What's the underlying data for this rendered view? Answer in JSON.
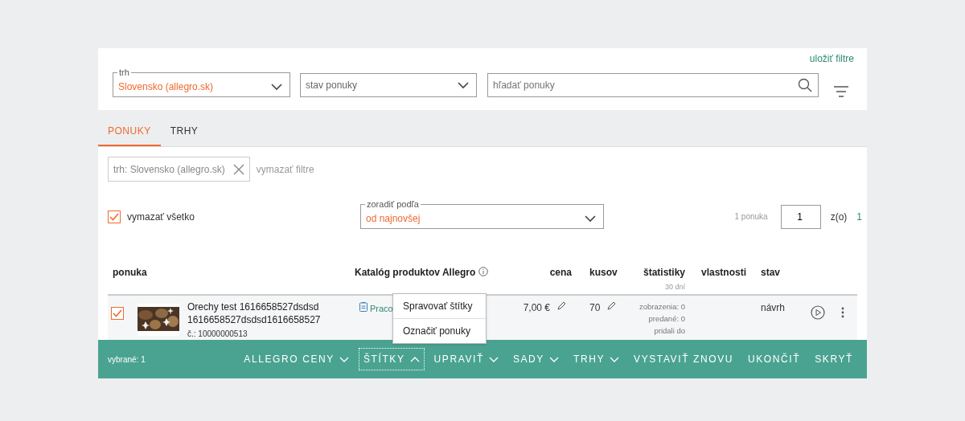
{
  "filters": {
    "save_link": "uložiť filtre",
    "market": {
      "label": "trh",
      "value": "Slovensko (allegro.sk)"
    },
    "status": {
      "placeholder": "stav ponuky"
    },
    "search": {
      "placeholder": "hľadať ponuky"
    }
  },
  "tabs": [
    {
      "label": "PONUKY",
      "selected": true
    },
    {
      "label": "TRHY",
      "selected": false
    }
  ],
  "active_filters": [
    {
      "text": "trh: Slovensko (allegro.sk)"
    }
  ],
  "clear_filters": "vymazať filtre",
  "select_all": {
    "label": "vymazať všetko",
    "checked": true
  },
  "sort": {
    "label": "zoradiť podľa",
    "value": "od najnovšej"
  },
  "pagination": {
    "count": "1 ponuka",
    "page": "1",
    "of": "z(o)",
    "total": "1"
  },
  "columns": [
    {
      "label": "ponuka",
      "info": false
    },
    {
      "label": "Katalóg produktov Allegro",
      "info": true
    },
    {
      "label": "cena",
      "info": false
    },
    {
      "label": "kusov",
      "info": false
    },
    {
      "label": "štatistiky",
      "sub": "30 dní",
      "info": false
    },
    {
      "label": "vlastnosti",
      "info": false
    },
    {
      "label": "stav",
      "info": false
    }
  ],
  "rows": [
    {
      "selected": true,
      "title": "Orechy test 1616658527dsdsd 1616658527dsdsd1616658527",
      "number_label": "č.:",
      "number": "10000000513",
      "catalog": "Praco",
      "price": "7,00 €",
      "quantity": "70",
      "stats": [
        {
          "label": "zobrazenia:",
          "value": "0"
        },
        {
          "label": "predané:",
          "value": "0"
        },
        {
          "label": "pridali do"
        }
      ],
      "status": "návrh"
    }
  ],
  "action_bar": {
    "selected_label": "vybrané: 1",
    "actions": [
      {
        "label": "ALLEGRO CENY",
        "kind": "dropdown",
        "expanded": false
      },
      {
        "label": "ŠTÍTKY",
        "kind": "dropdown",
        "expanded": true
      },
      {
        "label": "UPRAVIŤ",
        "kind": "dropdown",
        "expanded": false
      },
      {
        "label": "SADY",
        "kind": "dropdown",
        "expanded": false
      },
      {
        "label": "TRHY",
        "kind": "dropdown",
        "expanded": false
      },
      {
        "label": "VYSTAVIŤ ZNOVU",
        "kind": "button"
      },
      {
        "label": "UKONČIŤ",
        "kind": "button"
      },
      {
        "label": "SKRYŤ",
        "kind": "button"
      }
    ]
  },
  "menu": {
    "items": [
      {
        "label": "Spravovať štítky"
      },
      {
        "label": "Označiť ponuky"
      }
    ]
  }
}
